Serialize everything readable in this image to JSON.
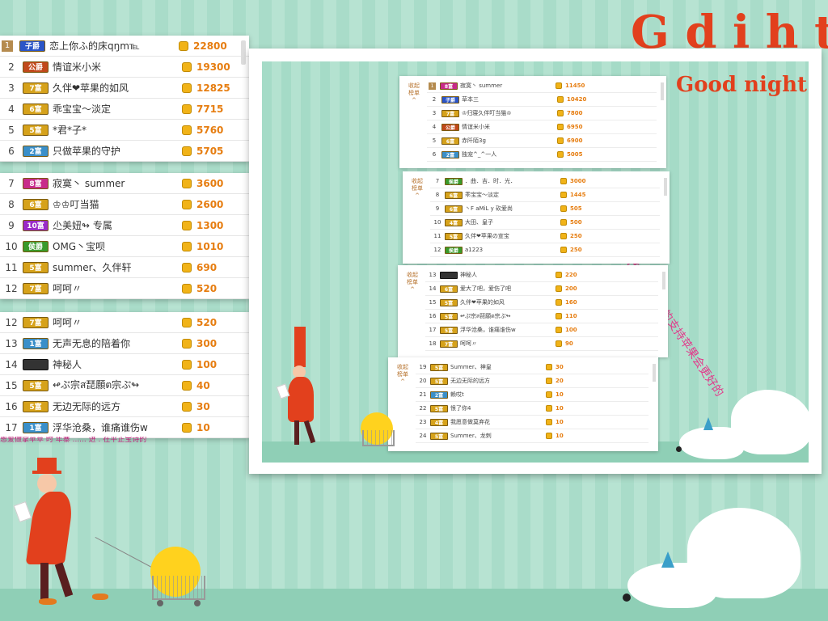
{
  "background": {
    "title_fragment": "G   d   i   h t",
    "colors": {
      "stripe_light": "#b7e3d2",
      "stripe_dark": "#a9dcc9",
      "accent_red": "#e2401d",
      "score_orange": "#e67d10",
      "pink": "#e23a8b"
    }
  },
  "left_panels": [
    {
      "rows": [
        {
          "rank": "1",
          "badge": "子爵",
          "badge_color": "#2b55c8",
          "name": "恋上你ふ的床qŋm℡",
          "score": "22800",
          "top": true
        },
        {
          "rank": "2",
          "badge": "公爵",
          "badge_color": "#c1491b",
          "name": "情谊米小米",
          "score": "19300"
        },
        {
          "rank": "3",
          "badge": "7富",
          "badge_color": "#d6a21b",
          "name": "久伴❤苹果的如风",
          "score": "12825"
        },
        {
          "rank": "4",
          "badge": "6富",
          "badge_color": "#d6a21b",
          "name": "乖宝宝～淡定",
          "score": "7715"
        },
        {
          "rank": "5",
          "badge": "5富",
          "badge_color": "#d6a21b",
          "name": "*君*子*",
          "score": "5760"
        },
        {
          "rank": "6",
          "badge": "2富",
          "badge_color": "#3a8fc9",
          "name": "只做苹果的守护",
          "score": "5705"
        }
      ]
    },
    {
      "rows": [
        {
          "rank": "7",
          "badge": "8富",
          "badge_color": "#c82b8a",
          "name": "寂寞丶 summer",
          "score": "3600"
        },
        {
          "rank": "8",
          "badge": "6富",
          "badge_color": "#d6a21b",
          "name": "♔♔叮当猫",
          "score": "2600"
        },
        {
          "rank": "9",
          "badge": "10富",
          "badge_color": "#9a2bc8",
          "name": "尐美妞↬ 专属",
          "score": "1300"
        },
        {
          "rank": "10",
          "badge": "侯爵",
          "badge_color": "#3a9a2b",
          "name": "OMG丶宝呗",
          "score": "1010"
        },
        {
          "rank": "11",
          "badge": "5富",
          "badge_color": "#d6a21b",
          "name": "summer、久伴轩",
          "score": "690"
        },
        {
          "rank": "12",
          "badge": "7富",
          "badge_color": "#d6a21b",
          "name": "呵呵〃",
          "score": "520"
        }
      ]
    },
    {
      "rows": [
        {
          "rank": "12",
          "badge": "7富",
          "badge_color": "#d6a21b",
          "name": "呵呵〃",
          "score": "520"
        },
        {
          "rank": "13",
          "badge": "1富",
          "badge_color": "#3a8fc9",
          "name": "无声无息的陪着你",
          "score": "300"
        },
        {
          "rank": "14",
          "badge": "",
          "badge_color": "",
          "name": "神秘人",
          "score": "100",
          "mystery": true
        },
        {
          "rank": "15",
          "badge": "5富",
          "badge_color": "#d6a21b",
          "name": "↫ぷ宗ส琵願ต宗ぷ↬",
          "score": "40"
        },
        {
          "rank": "16",
          "badge": "5富",
          "badge_color": "#d6a21b",
          "name": "无边无际的远方",
          "score": "30"
        },
        {
          "rank": "17",
          "badge": "1富",
          "badge_color": "#3a8fc9",
          "name": "浮华沧桑，谁痛谁伤w",
          "score": "10"
        }
      ],
      "clipped_text": "恩爱做掌苹苹 时 年寨 ...... 进 . 在平正宝诗的"
    }
  ],
  "framed": {
    "title": "Good night",
    "thanks": "感谢所有宝宝们的陪伴，有你们的支持苹果会更好的",
    "side_label": "收起\n榜单\n^",
    "panels": [
      {
        "rows": [
          {
            "rank": "1",
            "badge": "8富",
            "badge_color": "#c82b8a",
            "name": "寂寞丶 summer",
            "score": "11450",
            "top": true
          },
          {
            "rank": "2",
            "badge": "子爵",
            "badge_color": "#2b55c8",
            "name": "草本三",
            "score": "10420"
          },
          {
            "rank": "3",
            "badge": "7富",
            "badge_color": "#d6a21b",
            "name": "♔归寝久伴叮当猫♔",
            "score": "7800"
          },
          {
            "rank": "4",
            "badge": "公爵",
            "badge_color": "#c1491b",
            "name": "情谊米小米",
            "score": "6950"
          },
          {
            "rank": "5",
            "badge": "6富",
            "badge_color": "#d6a21b",
            "name": "赤阡陌3g",
            "score": "6900"
          },
          {
            "rank": "6",
            "badge": "2富",
            "badge_color": "#3a8fc9",
            "name": "独宠^_^一人",
            "score": "5005"
          }
        ]
      },
      {
        "rows": [
          {
            "rank": "7",
            "badge": "侯爵",
            "badge_color": "#3a9a2b",
            "name": "．曲．吉．时．光．",
            "score": "3000"
          },
          {
            "rank": "8",
            "badge": "6富",
            "badge_color": "#d6a21b",
            "name": "乖宝宝～淡定",
            "score": "1445"
          },
          {
            "rank": "9",
            "badge": "6富",
            "badge_color": "#d6a21b",
            "name": "丶F aMiL y 砍爱尚",
            "score": "505"
          },
          {
            "rank": "10",
            "badge": "4富",
            "badge_color": "#d6a21b",
            "name": "大田、皇子",
            "score": "500"
          },
          {
            "rank": "11",
            "badge": "5富",
            "badge_color": "#d6a21b",
            "name": "久伴❤苹果の宣宝",
            "score": "250"
          },
          {
            "rank": "12",
            "badge": "侯爵",
            "badge_color": "#3a9a2b",
            "name": "a1223",
            "score": "250"
          }
        ]
      },
      {
        "rows": [
          {
            "rank": "13",
            "badge": "",
            "badge_color": "",
            "name": "神秘人",
            "score": "220",
            "mystery": true
          },
          {
            "rank": "14",
            "badge": "6富",
            "badge_color": "#d6a21b",
            "name": "爱大了吧，爱伤了吧",
            "score": "200"
          },
          {
            "rank": "15",
            "badge": "5富",
            "badge_color": "#d6a21b",
            "name": "久伴❤苹果的如风",
            "score": "160"
          },
          {
            "rank": "16",
            "badge": "5富",
            "badge_color": "#d6a21b",
            "name": "↫ぷ宗ส琵願ต宗ぷ↬",
            "score": "110"
          },
          {
            "rank": "17",
            "badge": "5富",
            "badge_color": "#d6a21b",
            "name": "浮华沧桑，谁痛谁伤w",
            "score": "100"
          },
          {
            "rank": "18",
            "badge": "7富",
            "badge_color": "#d6a21b",
            "name": "呵呵〃",
            "score": "90"
          }
        ]
      },
      {
        "rows": [
          {
            "rank": "19",
            "badge": "5富",
            "badge_color": "#d6a21b",
            "name": "Summer、神皇",
            "score": "30"
          },
          {
            "rank": "20",
            "badge": "5富",
            "badge_color": "#d6a21b",
            "name": "无边无际的远方",
            "score": "20"
          },
          {
            "rank": "21",
            "badge": "2富",
            "badge_color": "#3a8fc9",
            "name": "赖哎t",
            "score": "10"
          },
          {
            "rank": "22",
            "badge": "5富",
            "badge_color": "#d6a21b",
            "name": "恨了你4",
            "score": "10"
          },
          {
            "rank": "23",
            "badge": "4富",
            "badge_color": "#d6a21b",
            "name": "我愿意做莫弃花",
            "score": "10"
          },
          {
            "rank": "24",
            "badge": "5富",
            "badge_color": "#d6a21b",
            "name": "Summer、龙刺",
            "score": "10"
          }
        ]
      }
    ]
  }
}
